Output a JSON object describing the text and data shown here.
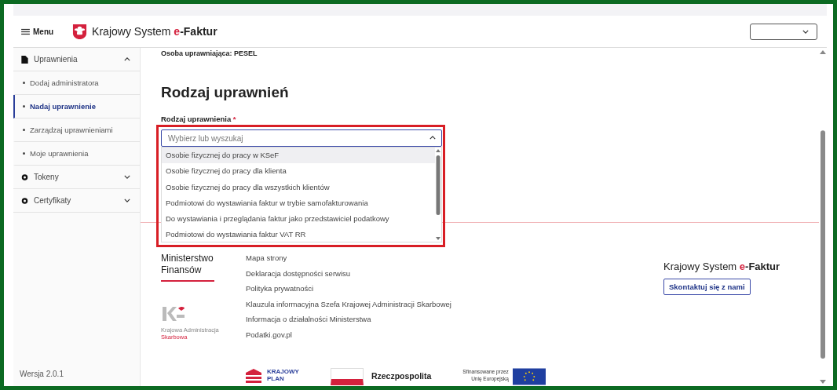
{
  "header": {
    "menu_label": "Menu",
    "brand": {
      "prefix": "Krajowy System",
      "accent": "e",
      "suffix": "-Faktur"
    }
  },
  "sidebar": {
    "items": [
      {
        "label": "Uprawnienia",
        "expanded": true,
        "children": [
          {
            "label": "Dodaj administratora",
            "selected": false
          },
          {
            "label": "Nadaj uprawnienie",
            "selected": true
          },
          {
            "label": "Zarządzaj uprawnieniami",
            "selected": false
          },
          {
            "label": "Moje uprawnienia",
            "selected": false
          }
        ]
      },
      {
        "label": "Tokeny",
        "expanded": false
      },
      {
        "label": "Certyfikaty",
        "expanded": false
      }
    ],
    "version": "Wersja 2.0.1"
  },
  "main": {
    "grantor": "Osoba uprawniająca: PESEL",
    "heading": "Rodzaj uprawnień",
    "field": {
      "label": "Rodzaj uprawnienia",
      "required_mark": "*",
      "placeholder": "Wybierz lub wyszukaj",
      "expanded": true,
      "options": [
        {
          "label": "Osobie fizycznej do pracy w KSeF",
          "highlighted": true
        },
        {
          "label": "Osobie fizycznej do pracy dla klienta",
          "highlighted": false
        },
        {
          "label": "Osobie fizycznej do pracy dla wszystkich klientów",
          "highlighted": false
        },
        {
          "label": "Podmiotowi do wystawiania faktur w trybie samofakturowania",
          "highlighted": false
        },
        {
          "label": "Do wystawiania i przeglądania faktur jako przedstawiciel podatkowy",
          "highlighted": false
        },
        {
          "label": "Podmiotowi do wystawiania faktur VAT RR",
          "highlighted": false
        }
      ]
    }
  },
  "footer": {
    "ministry": "Ministerstwo Finansów",
    "kas": {
      "line_1": "Krajowa Administracja",
      "line_2": "Skarbowa"
    },
    "links": [
      "Mapa strony",
      "Deklaracja dostępności serwisu",
      "Polityka prywatności",
      "Klauzula informacyjna Szefa Krajowej Administracji Skarbowej",
      "Informacja o działalności Ministerstwa",
      "Podatki.gov.pl"
    ],
    "brand": {
      "prefix": "Krajowy System",
      "accent": "e",
      "suffix": "-Faktur"
    },
    "contact_button": "Skontaktuj się z nami",
    "plan_logo": [
      "KRAJOWY",
      "PLAN"
    ],
    "republic_logo": "Rzeczpospolita",
    "eu_note": [
      "Sfinansowane przez",
      "Unię Europejską"
    ]
  }
}
